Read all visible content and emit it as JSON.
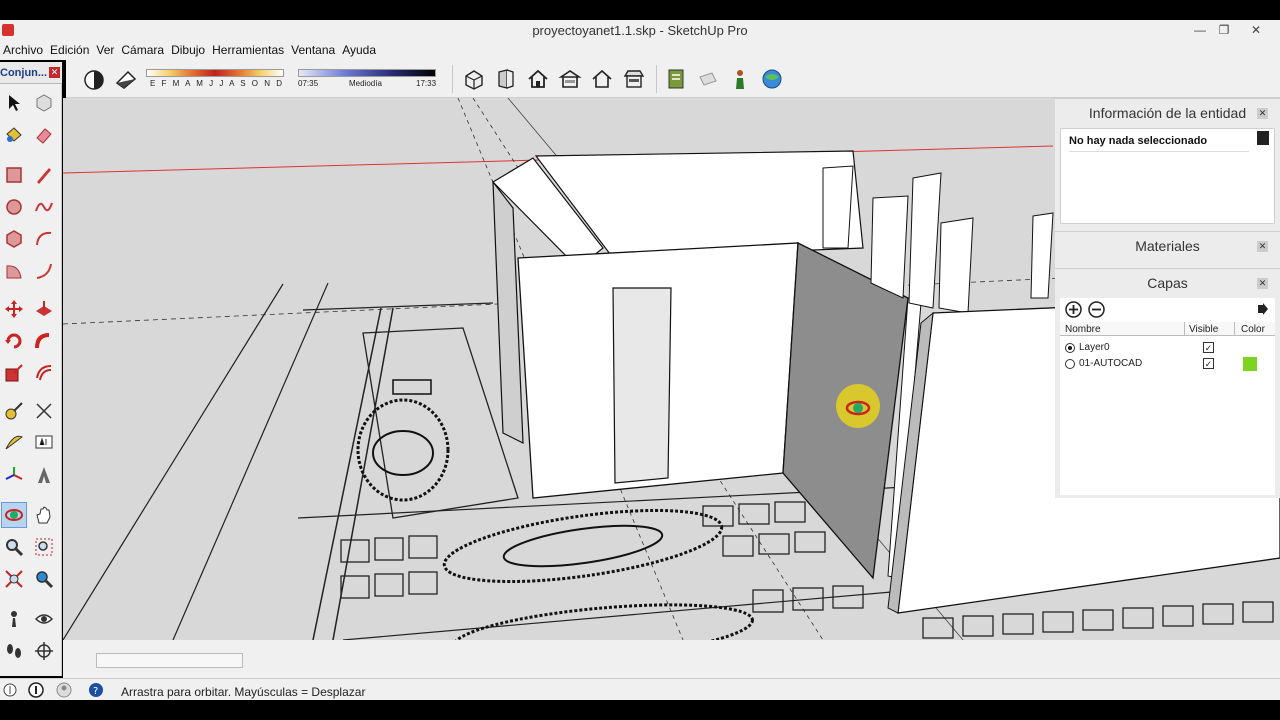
{
  "window": {
    "title": "proyectoyanet1.1.skp - SketchUp Pro"
  },
  "menu": [
    "Archivo",
    "Edición",
    "Ver",
    "Cámara",
    "Dibujo",
    "Herramientas",
    "Ventana",
    "Ayuda"
  ],
  "shadows": {
    "months": "E F M A M J J A S O N D",
    "time_start": "07:35",
    "time_mid": "Mediodía",
    "time_end": "17:33"
  },
  "left_panel": {
    "title": "Conjun..."
  },
  "entity_info": {
    "title": "Información de la entidad",
    "status": "No hay nada seleccionado"
  },
  "materials": {
    "title": "Materiales"
  },
  "layers": {
    "title": "Capas",
    "columns": {
      "name": "Nombre",
      "visible": "Visible",
      "color": "Color"
    },
    "rows": [
      {
        "name": "Layer0",
        "active": true,
        "visible": true,
        "color": ""
      },
      {
        "name": "01-AUTOCAD",
        "active": false,
        "visible": true,
        "color": "#7ed321"
      }
    ]
  },
  "status": {
    "hint": "Arrastra para orbitar. Mayúsculas = Desplazar"
  }
}
